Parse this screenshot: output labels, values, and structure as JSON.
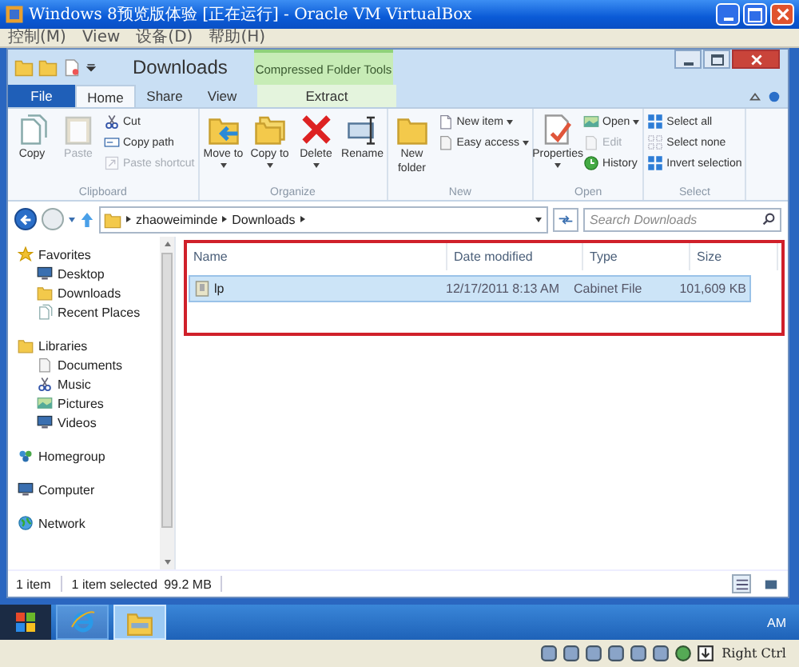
{
  "vm": {
    "title": "Windows 8预览版体验 [正在运行] - Oracle VM VirtualBox",
    "menu": [
      "控制(M)",
      "View",
      "设备(D)",
      "帮助(H)"
    ]
  },
  "explorer": {
    "title": "Downloads",
    "context_group": "Compressed Folder Tools",
    "tabs": [
      {
        "label": "File",
        "kind": "file",
        "selected": false
      },
      {
        "label": "Home",
        "kind": "tab",
        "selected": true
      },
      {
        "label": "Share",
        "kind": "tab",
        "selected": false
      },
      {
        "label": "View",
        "kind": "tab",
        "selected": false
      },
      {
        "label": "Extract",
        "kind": "context",
        "selected": false
      }
    ],
    "ribbon": [
      {
        "name": "Clipboard",
        "items": [
          {
            "label": "Copy",
            "kind": "large",
            "dropdown": false,
            "disabled": false
          },
          {
            "label": "Paste",
            "kind": "large",
            "dropdown": false,
            "disabled": true
          },
          {
            "label": "Cut",
            "kind": "small",
            "dropdown": false,
            "disabled": false
          },
          {
            "label": "Copy path",
            "kind": "small",
            "dropdown": false,
            "disabled": false
          },
          {
            "label": "Paste shortcut",
            "kind": "small",
            "dropdown": false,
            "disabled": true
          }
        ]
      },
      {
        "name": "Organize",
        "items": [
          {
            "label": "Move to",
            "kind": "large",
            "dropdown": true,
            "disabled": false
          },
          {
            "label": "Copy to",
            "kind": "large",
            "dropdown": true,
            "disabled": false
          },
          {
            "label": "Delete",
            "kind": "large",
            "dropdown": true,
            "disabled": false
          },
          {
            "label": "Rename",
            "kind": "large",
            "dropdown": false,
            "disabled": false
          }
        ]
      },
      {
        "name": "New",
        "items": [
          {
            "label": "New folder",
            "kind": "large",
            "dropdown": false,
            "disabled": false
          },
          {
            "label": "New item",
            "kind": "small",
            "dropdown": true,
            "disabled": false
          },
          {
            "label": "Easy access",
            "kind": "small",
            "dropdown": true,
            "disabled": false
          }
        ]
      },
      {
        "name": "Open",
        "items": [
          {
            "label": "Properties",
            "kind": "large",
            "dropdown": true,
            "disabled": false
          },
          {
            "label": "Open",
            "kind": "small",
            "dropdown": true,
            "disabled": false
          },
          {
            "label": "Edit",
            "kind": "small",
            "dropdown": false,
            "disabled": true
          },
          {
            "label": "History",
            "kind": "small",
            "dropdown": false,
            "disabled": false
          }
        ]
      },
      {
        "name": "Select",
        "items": [
          {
            "label": "Select all",
            "kind": "small",
            "dropdown": false,
            "disabled": false
          },
          {
            "label": "Select none",
            "kind": "small",
            "dropdown": false,
            "disabled": false
          },
          {
            "label": "Invert selection",
            "kind": "small",
            "dropdown": false,
            "disabled": false
          }
        ]
      }
    ],
    "address": {
      "path": [
        "zhaoweiminde",
        "Downloads"
      ]
    },
    "search": {
      "placeholder": "Search Downloads"
    },
    "nav": [
      {
        "label": "Favorites",
        "children": [
          {
            "label": "Desktop"
          },
          {
            "label": "Downloads"
          },
          {
            "label": "Recent Places"
          }
        ]
      },
      {
        "label": "Libraries",
        "children": [
          {
            "label": "Documents"
          },
          {
            "label": "Music"
          },
          {
            "label": "Pictures"
          },
          {
            "label": "Videos"
          }
        ]
      },
      {
        "label": "Homegroup"
      },
      {
        "label": "Computer"
      },
      {
        "label": "Network"
      }
    ],
    "columns": [
      "Name",
      "Date modified",
      "Type",
      "Size"
    ],
    "rows": [
      {
        "cells": [
          "lp",
          "12/17/2011 8:13 AM",
          "Cabinet File",
          "101,609 KB"
        ],
        "selected": true
      }
    ],
    "status": {
      "count": "1 item",
      "selection": "1 item selected",
      "size": "99.2 MB"
    }
  },
  "taskbar": {
    "apps": [
      {
        "kind": "browser",
        "selected": false
      },
      {
        "kind": "explorer",
        "selected": true
      }
    ],
    "clock": "AM"
  },
  "vm_status": {
    "host_key": "Right Ctrl"
  }
}
